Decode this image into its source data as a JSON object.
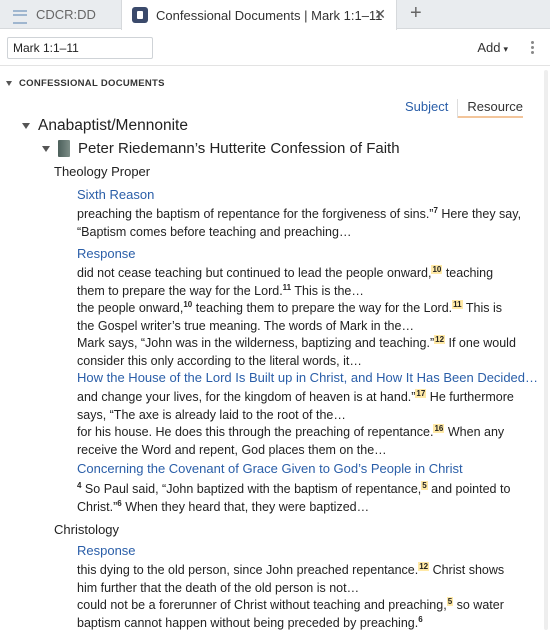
{
  "tabs": [
    {
      "label": "CDCR:DD"
    },
    {
      "label": "Confessional Documents | Mark 1:1–11",
      "close": "✕"
    }
  ],
  "tab_add": "+",
  "toolbar": {
    "reference": "Mark 1:1–11",
    "add_label": "Add",
    "add_caret": "▾"
  },
  "panel": {
    "section_title": "CONFESSIONAL DOCUMENTS",
    "view_subject": "Subject",
    "view_resource": "Resource"
  },
  "tree": {
    "group": "Anabaptist/Mennonite",
    "book": "Peter Riedemann’s Hutterite Confession of Faith",
    "categories": [
      "Theology Proper",
      "Christology"
    ]
  },
  "hits": [
    {
      "title": "Sixth Reason",
      "lines": [
        {
          "parts": [
            {
              "t": "preaching the baptism of repentance for the forgiveness of sins.”"
            },
            {
              "fn": "7"
            },
            {
              "t": " Here they say,"
            }
          ]
        },
        {
          "parts": [
            {
              "t": "“Baptism comes before teaching and preaching…"
            }
          ]
        }
      ]
    },
    {
      "title": "Response",
      "lines": [
        {
          "parts": [
            {
              "t": "did not cease teaching but continued to lead the people onward,"
            },
            {
              "fnh": "10"
            },
            {
              "t": " teaching"
            }
          ]
        },
        {
          "parts": [
            {
              "t": "them to prepare the way for the Lord."
            },
            {
              "fn": "11"
            },
            {
              "t": " This is the…"
            }
          ]
        },
        {
          "parts": [
            {
              "t": "the people onward,"
            },
            {
              "fn": "10"
            },
            {
              "t": " teaching them to prepare the way for the Lord."
            },
            {
              "fnh": "11"
            },
            {
              "t": " This is"
            }
          ]
        },
        {
          "parts": [
            {
              "t": "the Gospel writer’s true meaning. The words of Mark in the…"
            }
          ]
        },
        {
          "parts": [
            {
              "t": "Mark says, “John was in the wilderness, baptizing and teaching.”"
            },
            {
              "fnh": "12"
            },
            {
              "t": " If one would"
            }
          ]
        },
        {
          "parts": [
            {
              "t": "consider this only according to the literal words, it…"
            }
          ]
        }
      ]
    },
    {
      "title": "How the House of the Lord Is Built up in Christ, and How It Has Been Decided…",
      "lines": [
        {
          "parts": [
            {
              "t": "and change your lives, for the kingdom of heaven is at hand.”"
            },
            {
              "fnh": "17"
            },
            {
              "t": " He furthermore"
            }
          ]
        },
        {
          "parts": [
            {
              "t": "says, “The axe is already laid to the root of the…"
            }
          ]
        },
        {
          "parts": [
            {
              "t": "for his house. He does this through the preaching of repentance."
            },
            {
              "fnh": "16"
            },
            {
              "t": " When any"
            }
          ]
        },
        {
          "parts": [
            {
              "t": "receive the Word and repent, God places them on the…"
            }
          ]
        }
      ]
    },
    {
      "title": "Concerning the Covenant of Grace Given to God’s People in Christ",
      "lines": [
        {
          "parts": [
            {
              "fn": "4"
            },
            {
              "t": " So Paul said, “John baptized with the baptism of repentance,"
            },
            {
              "fnh": "5"
            },
            {
              "t": " and pointed to"
            }
          ]
        },
        {
          "parts": [
            {
              "t": "Christ.”"
            },
            {
              "fn": "6"
            },
            {
              "t": " When they heard that, they were baptized…"
            }
          ]
        }
      ]
    },
    {
      "title": "Response",
      "lines": [
        {
          "parts": [
            {
              "t": "this dying to the old person, since John preached repentance."
            },
            {
              "fnh": "12"
            },
            {
              "t": " Christ shows"
            }
          ]
        },
        {
          "parts": [
            {
              "t": "him further that the death of the old person is not…"
            }
          ]
        },
        {
          "parts": [
            {
              "t": "could not be a forerunner of Christ without teaching and preaching,"
            },
            {
              "fnh": "5"
            },
            {
              "t": " so water"
            }
          ]
        },
        {
          "parts": [
            {
              "t": "baptism cannot happen without being preceded by preaching."
            },
            {
              "fn": "6"
            }
          ]
        }
      ]
    }
  ]
}
